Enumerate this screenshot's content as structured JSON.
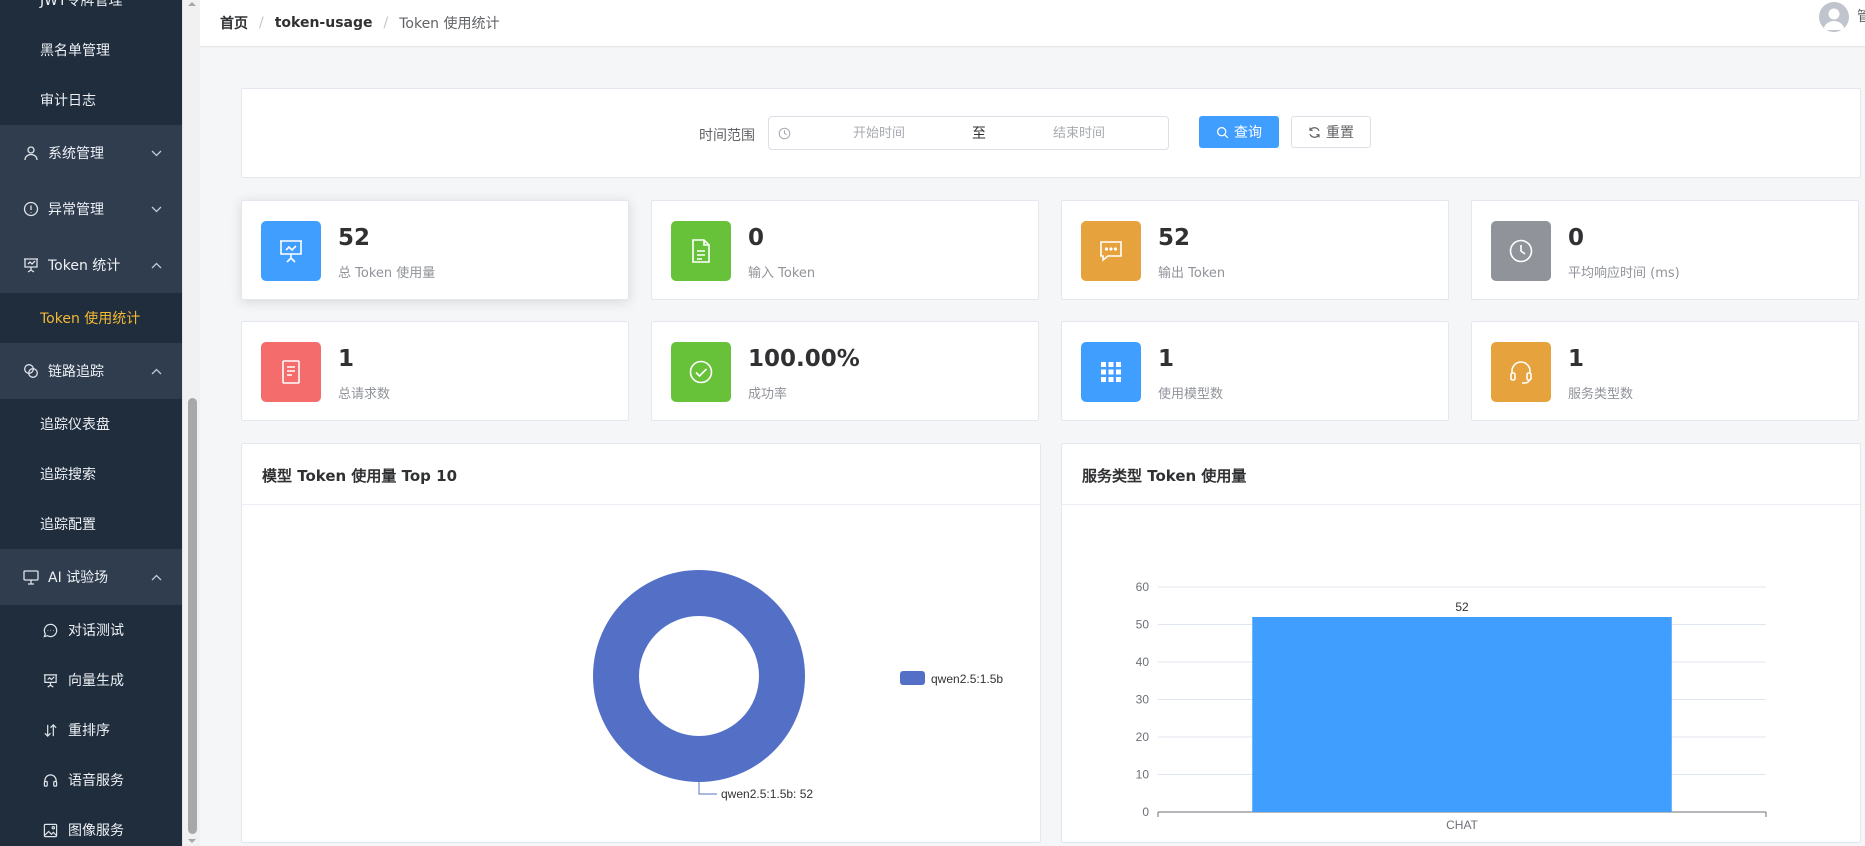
{
  "sidebar": {
    "top_items": [
      {
        "label": "JWT令牌管理"
      },
      {
        "label": "黑名单管理"
      },
      {
        "label": "审计日志"
      }
    ],
    "groups": [
      {
        "label": "系统管理",
        "icon": "user-icon",
        "expanded": false
      },
      {
        "label": "异常管理",
        "icon": "alert-circle-icon",
        "expanded": false
      },
      {
        "label": "Token 统计",
        "icon": "presentation-chart-icon",
        "expanded": true
      },
      {
        "label": "链路追踪",
        "icon": "link-icon",
        "expanded": true
      },
      {
        "label": "AI 试验场",
        "icon": "monitor-icon",
        "expanded": true
      }
    ],
    "token_items": [
      {
        "label": "Token 使用统计",
        "active": true
      }
    ],
    "trace_items": [
      {
        "label": "追踪仪表盘"
      },
      {
        "label": "追踪搜索"
      },
      {
        "label": "追踪配置"
      }
    ],
    "ai_items": [
      {
        "label": "对话测试",
        "icon": "chat-bubble-icon"
      },
      {
        "label": "向量生成",
        "icon": "presentation-icon"
      },
      {
        "label": "重排序",
        "icon": "sort-icon"
      },
      {
        "label": "语音服务",
        "icon": "headset-icon"
      },
      {
        "label": "图像服务",
        "icon": "image-icon"
      }
    ]
  },
  "header": {
    "breadcrumb": [
      "首页",
      "token-usage",
      "Token 使用统计"
    ],
    "user_text": "管"
  },
  "query": {
    "label": "时间范围",
    "start_placeholder": "开始时间",
    "separator": "至",
    "end_placeholder": "结束时间",
    "search_button": "查询",
    "reset_button": "重置"
  },
  "stats": [
    {
      "value": "52",
      "label": "总 Token 使用量",
      "color": "#409eff",
      "icon": "presentation-icon"
    },
    {
      "value": "0",
      "label": "输入 Token",
      "color": "#67c23a",
      "icon": "document-icon"
    },
    {
      "value": "52",
      "label": "输出 Token",
      "color": "#e6a23c",
      "icon": "chat-dots-icon"
    },
    {
      "value": "0",
      "label": "平均响应时间 (ms)",
      "color": "#909399",
      "icon": "clock-icon"
    },
    {
      "value": "1",
      "label": "总请求数",
      "color": "#f56c6c",
      "icon": "list-document-icon"
    },
    {
      "value": "100.00%",
      "label": "成功率",
      "color": "#67c23a",
      "icon": "check-circle-icon"
    },
    {
      "value": "1",
      "label": "使用模型数",
      "color": "#409eff",
      "icon": "grid-icon"
    },
    {
      "value": "1",
      "label": "服务类型数",
      "color": "#e6a23c",
      "icon": "headset-icon"
    }
  ],
  "charts": {
    "model_title": "模型 Token 使用量 Top 10",
    "service_title": "服务类型 Token 使用量"
  },
  "chart_data": [
    {
      "type": "pie",
      "title": "模型 Token 使用量 Top 10",
      "donut": true,
      "categories": [
        "qwen2.5:1.5b"
      ],
      "values": [
        52
      ],
      "slice_labels": [
        "qwen2.5:1.5b: 52"
      ],
      "colors": [
        "#5470c6"
      ],
      "legend": {
        "placement": "right",
        "entries": [
          "qwen2.5:1.5b"
        ]
      }
    },
    {
      "type": "bar",
      "title": "服务类型 Token 使用量",
      "categories": [
        "CHAT"
      ],
      "values": [
        52
      ],
      "data_labels": [
        "52"
      ],
      "ylim": [
        0,
        60
      ],
      "yticks": [
        0,
        10,
        20,
        30,
        40,
        50,
        60
      ],
      "grid": true,
      "bar_color": "#409eff"
    }
  ]
}
